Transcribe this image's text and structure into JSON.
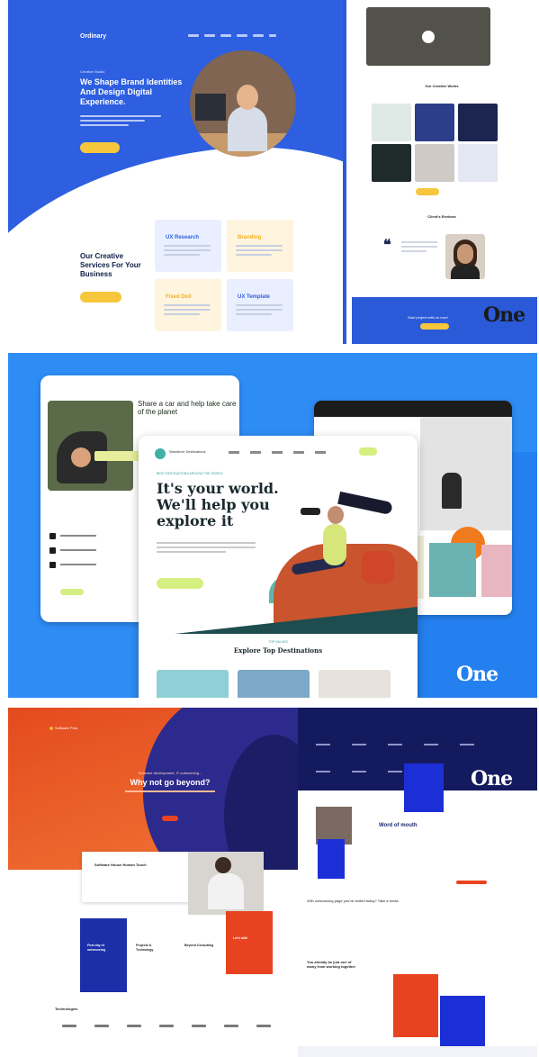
{
  "brand_mark": "One",
  "panel1": {
    "logo": "Ordinary",
    "eyebrow": "Creative Studio",
    "headline": "We Shape Brand Identities And Design Digital Experience.",
    "services_title": "Our Creative Services For Your Business",
    "cards": [
      {
        "title": "UX Research",
        "color": "#e9efff",
        "title_color": "#2f5fe0"
      },
      {
        "title": "Branding",
        "color": "#fff5de",
        "title_color": "#f2b227"
      },
      {
        "title": "Fixed Doll",
        "color": "#fff5de",
        "title_color": "#f2b227"
      },
      {
        "title": "UX Template",
        "color": "#e9efff",
        "title_color": "#2f5fe0"
      }
    ],
    "works_title": "Our Creative Works",
    "reviews_title": "Client's Reviews",
    "footer_text": "Start project with us now!",
    "accent": "#f6c63c"
  },
  "panel2": {
    "share_headline": "Share a car and help take care of the planet",
    "main_logo_text": "Wanderer Destinations",
    "eyebrow": "BEST DESTINATIONS AROUND THE WORLD",
    "headline": "It's your world. We'll help you explore it",
    "explore_eyebrow": "TOP VALUES",
    "explore_title": "Explore Top Destinations",
    "accent": "#d6ef81"
  },
  "panel3": {
    "logo": "Software Pros",
    "tagline": "Software development, IT outsourcing...",
    "headline": "Why not go beyond?",
    "card_title": "Software House Human Touch",
    "tiles": [
      {
        "title": "First day of outsourcing",
        "bg": "#1a2fa8",
        "fg": "#ffffff"
      },
      {
        "title": "Projects & Technology",
        "bg": "#ffffff",
        "fg": "#222222"
      },
      {
        "title": "Beyond Consulting",
        "bg": "#ffffff",
        "fg": "#222222"
      },
      {
        "title": "Let's talk!",
        "bg": "#e84320",
        "fg": "#ffffff"
      }
    ],
    "technologies": "Technologies",
    "word_of_mouth": "Word of mouth",
    "outsourcing_line": "20th outsourcing page you've visited today? Take a break",
    "beyond_text": "You already be just one of many from working together"
  }
}
